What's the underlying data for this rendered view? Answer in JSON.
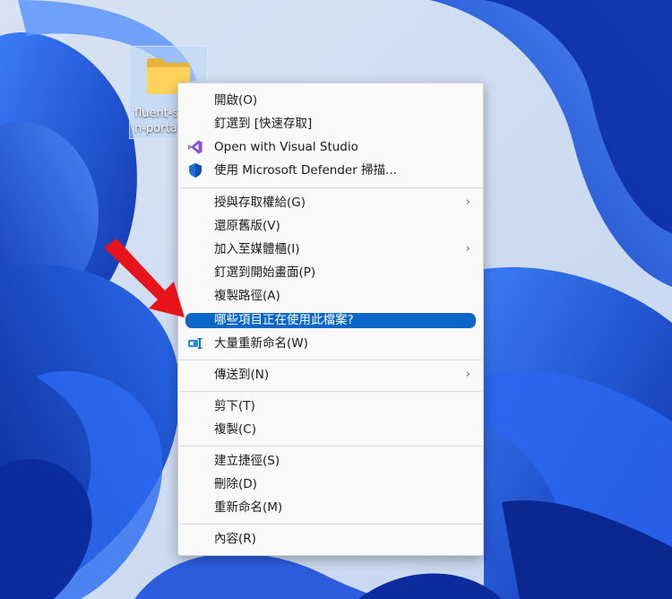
{
  "desktop": {
    "folder_label_line1": "fluent-s",
    "folder_label_line2": "h-porta",
    "folder_icon": "folder-icon"
  },
  "context_menu": {
    "items": [
      {
        "label": "開啟(O)"
      },
      {
        "label": "釘選到 [快速存取]"
      },
      {
        "label": "Open with Visual Studio",
        "icon": "visual-studio-icon"
      },
      {
        "label": "使用 Microsoft Defender 掃描...",
        "icon": "defender-shield-icon"
      },
      {
        "label": "授與存取權給(G)",
        "submenu": true
      },
      {
        "label": "還原舊版(V)"
      },
      {
        "label": "加入至媒體櫃(I)",
        "submenu": true
      },
      {
        "label": "釘選到開始畫面(P)"
      },
      {
        "label": "複製路徑(A)"
      },
      {
        "label": "哪些項目正在使用此檔案?",
        "highlighted": true
      },
      {
        "label": "大量重新命名(W)",
        "icon": "powerrename-icon"
      },
      {
        "label": "傳送到(N)",
        "submenu": true
      },
      {
        "label": "剪下(T)"
      },
      {
        "label": "複製(C)"
      },
      {
        "label": "建立捷徑(S)"
      },
      {
        "label": "刪除(D)"
      },
      {
        "label": "重新命名(M)"
      },
      {
        "label": "內容(R)"
      }
    ],
    "submenu_glyph": "›"
  },
  "annotation": {
    "arrow_color": "#e8141c"
  },
  "colors": {
    "highlight": "#0a67c8",
    "wallpaper_blue": "#1b49d8"
  }
}
